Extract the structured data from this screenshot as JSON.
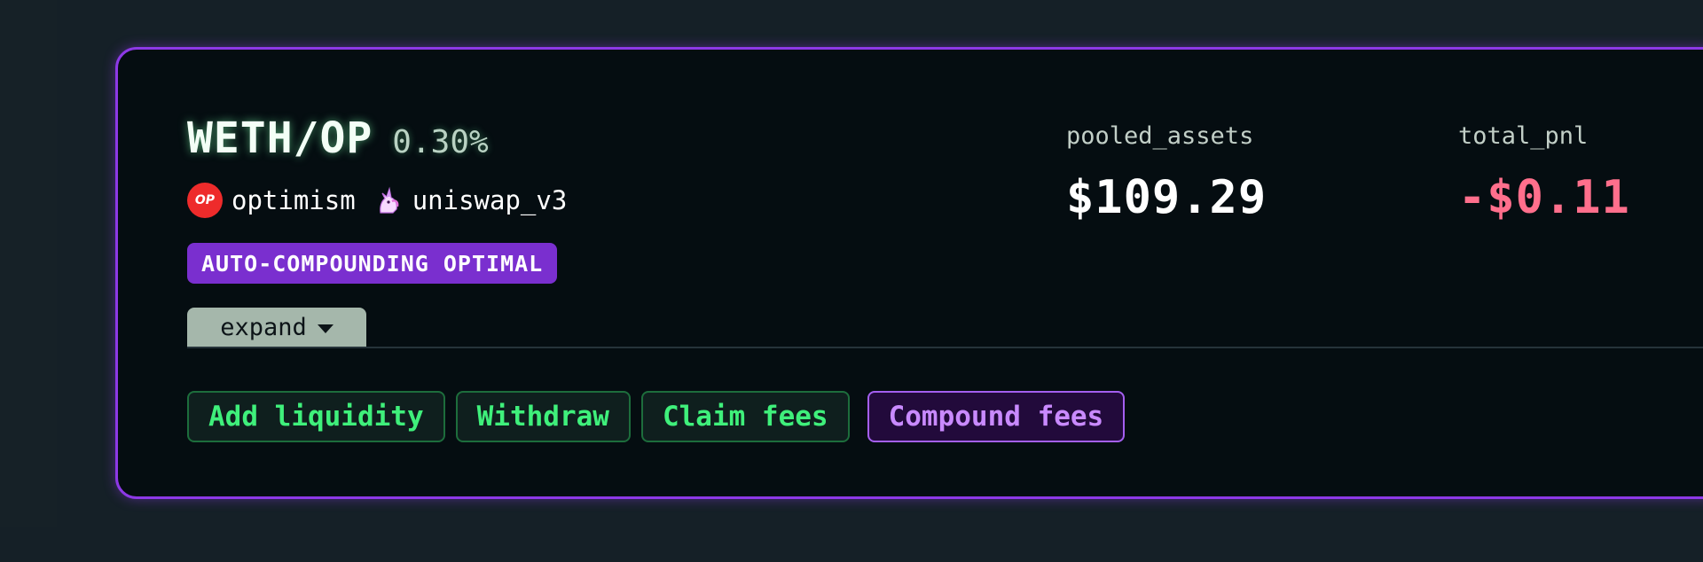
{
  "position": {
    "pair": "WETH/OP",
    "fee_tier": "0.30%",
    "network": "optimism",
    "network_icon_text": "OP",
    "protocol": "uniswap_v3",
    "strategy_badge": "AUTO-COMPOUNDING OPTIMAL",
    "expand_label": "expand"
  },
  "stats": {
    "pooled_label": "pooled_assets",
    "pooled_value": "$109.29",
    "pnl_label": "total_pnl",
    "pnl_value": "-$0.11"
  },
  "actions": {
    "add_liquidity": "Add liquidity",
    "withdraw": "Withdraw",
    "claim_fees": "Claim fees",
    "compound_fees": "Compound fees"
  },
  "colors": {
    "card_border": "#8d39e6",
    "badge_bg": "#7a2fcf",
    "action_green": "#3ff07b",
    "action_purple": "#c98aff",
    "pnl_negative": "#ff6f8c"
  },
  "icons": {
    "network": "optimism-icon",
    "protocol": "unicorn-icon",
    "expand": "caret-down-icon"
  }
}
